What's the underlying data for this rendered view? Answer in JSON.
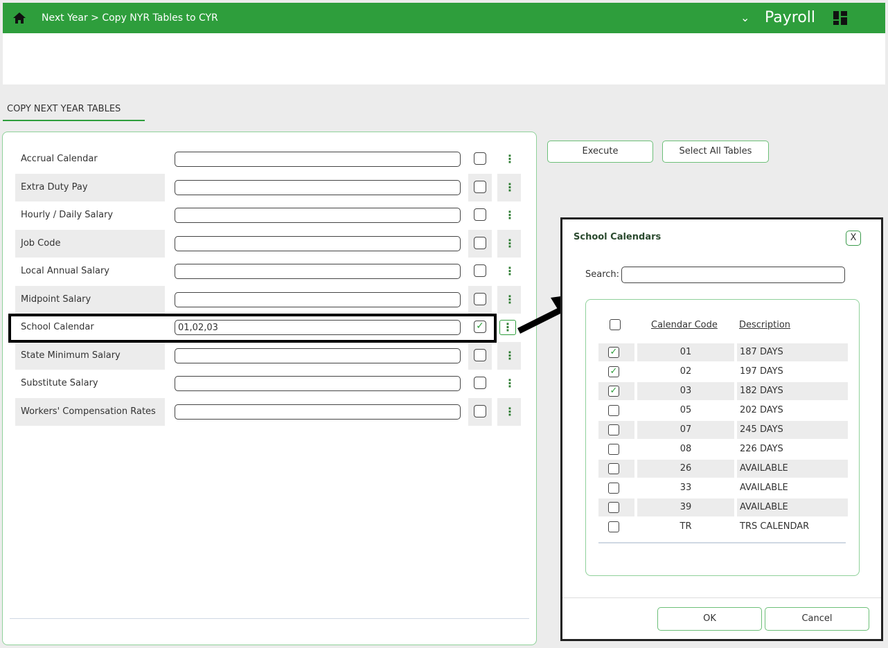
{
  "header": {
    "breadcrumb": "Next Year > Copy NYR Tables to CYR",
    "module_chevron": "⌄",
    "module": "Payroll",
    "icons": {
      "home": "home-icon",
      "apps": "grid-icon"
    }
  },
  "section": {
    "tab_label": "COPY NEXT YEAR TABLES"
  },
  "form": {
    "rows": [
      {
        "label": "Accrual Calendar",
        "value": "",
        "checked": false
      },
      {
        "label": "Extra Duty Pay",
        "value": "",
        "checked": false
      },
      {
        "label": "Hourly / Daily Salary",
        "value": "",
        "checked": false
      },
      {
        "label": "Job Code",
        "value": "",
        "checked": false
      },
      {
        "label": "Local Annual Salary",
        "value": "",
        "checked": false
      },
      {
        "label": "Midpoint Salary",
        "value": "",
        "checked": false
      },
      {
        "label": "School Calendar",
        "value": "01,02,03",
        "checked": true
      },
      {
        "label": "State Minimum Salary",
        "value": "",
        "checked": false
      },
      {
        "label": "Substitute Salary",
        "value": "",
        "checked": false
      },
      {
        "label": "Workers' Compensation Rates",
        "value": "",
        "checked": false
      }
    ],
    "dots_glyph": "⋮",
    "check_glyph": "✓"
  },
  "actions": {
    "execute": "Execute",
    "select_all": "Select All Tables"
  },
  "dialog": {
    "title": "School Calendars",
    "close": "X",
    "search_label": "Search:",
    "search_value": "",
    "col_code": "Calendar Code",
    "col_desc": "Description",
    "rows": [
      {
        "code": "01",
        "desc": "187 DAYS",
        "checked": true
      },
      {
        "code": "02",
        "desc": "197 DAYS",
        "checked": true
      },
      {
        "code": "03",
        "desc": "182 DAYS",
        "checked": true
      },
      {
        "code": "05",
        "desc": "202 DAYS",
        "checked": false
      },
      {
        "code": "07",
        "desc": "245 DAYS",
        "checked": false
      },
      {
        "code": "08",
        "desc": "226 DAYS",
        "checked": false
      },
      {
        "code": "26",
        "desc": "AVAILABLE",
        "checked": false
      },
      {
        "code": "33",
        "desc": "AVAILABLE",
        "checked": false
      },
      {
        "code": "39",
        "desc": "AVAILABLE",
        "checked": false
      },
      {
        "code": "TR",
        "desc": "TRS CALENDAR",
        "checked": false
      }
    ],
    "ok": "OK",
    "cancel": "Cancel"
  },
  "colors": {
    "brand_green": "#2e9e3c",
    "panel_border": "#8fd19a",
    "annotation": "#000000"
  }
}
